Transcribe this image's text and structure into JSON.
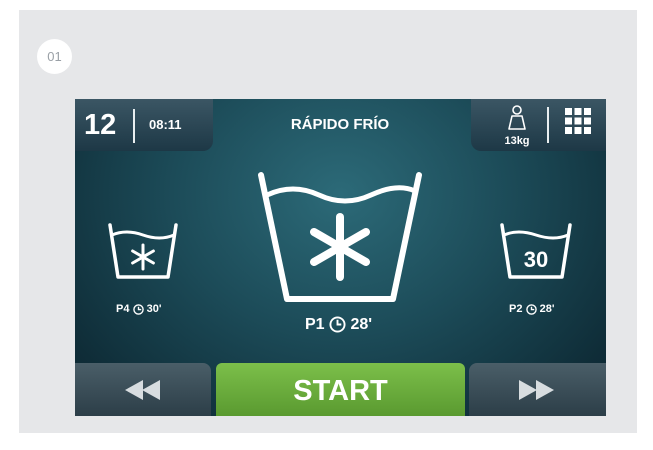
{
  "badge": "01",
  "header": {
    "cycle_number": "12",
    "time": "08:11",
    "program_title": "RÁPIDO FRÍO",
    "weight": "13kg"
  },
  "programs": {
    "left": {
      "code": "P4",
      "time": "30'",
      "icon": "snowflake-tub-icon"
    },
    "center": {
      "code": "P1",
      "time": "28'",
      "icon": "snowflake-tub-icon"
    },
    "right": {
      "code": "P2",
      "time": "28'",
      "icon": "temp-30-tub-icon",
      "temp_text": "30"
    }
  },
  "controls": {
    "start_label": "START",
    "prev_icon": "rewind-icon",
    "next_icon": "fast-forward-icon",
    "menu_icon": "grid-menu-icon",
    "weight_icon": "weight-icon"
  },
  "colors": {
    "panel": "#e6e7e9",
    "screen": "#1c4b58",
    "start": "#6aad3c"
  }
}
